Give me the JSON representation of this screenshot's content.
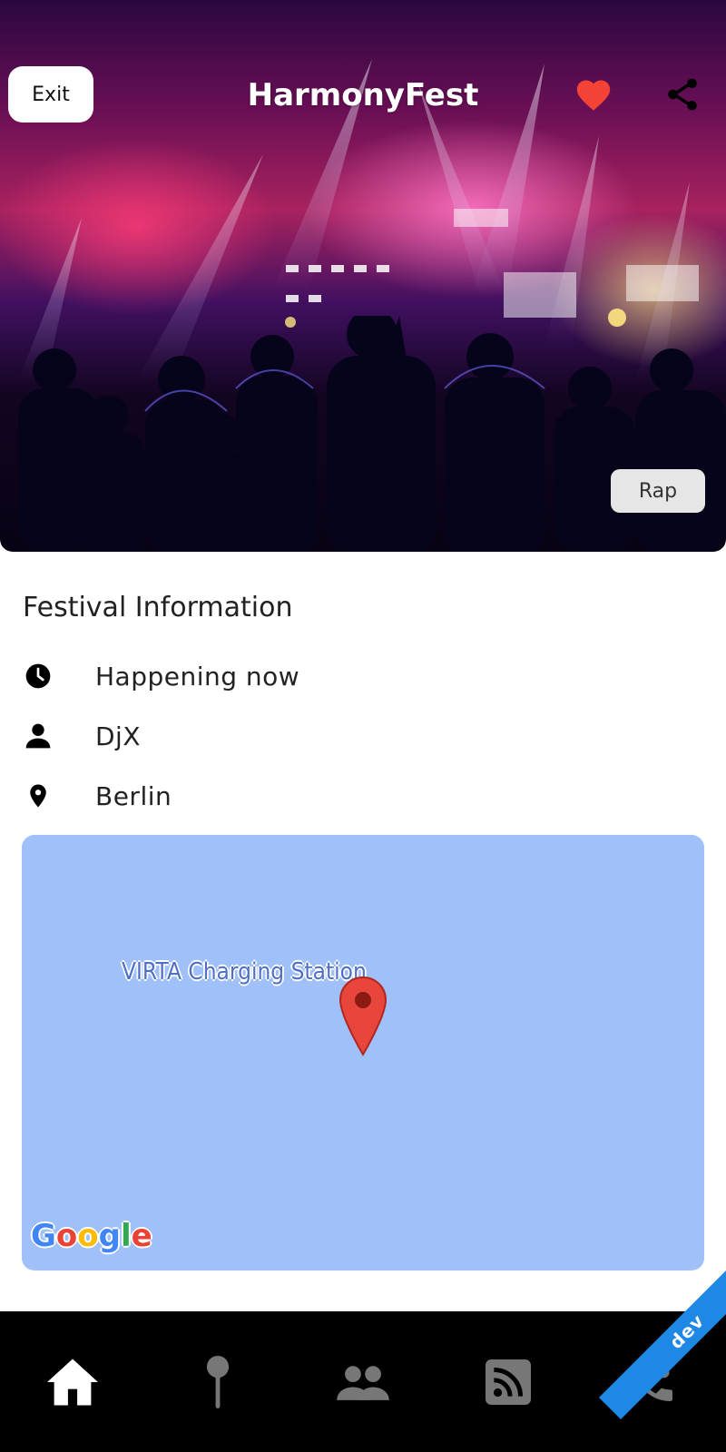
{
  "header": {
    "exit_label": "Exit",
    "title": "HarmonyFest",
    "favorite_icon": "heart-icon",
    "share_icon": "share-icon",
    "genre_tag": "Rap",
    "favorite_color": "#f44336"
  },
  "info": {
    "section_title": "Festival Information",
    "rows": [
      {
        "icon": "clock-icon",
        "text": "Happening now"
      },
      {
        "icon": "person-icon",
        "text": "DjX"
      },
      {
        "icon": "location-pin-icon",
        "text": "Berlin"
      }
    ]
  },
  "map": {
    "place_label": "VIRTA Charging Station",
    "provider_logo": "Google",
    "background_color": "#9fc0f8"
  },
  "bottom_nav": {
    "items": [
      {
        "icon": "home-icon",
        "active": true
      },
      {
        "icon": "pin-icon",
        "active": false
      },
      {
        "icon": "people-icon",
        "active": false
      },
      {
        "icon": "rss-feed-icon",
        "active": false
      },
      {
        "icon": "phone-fire-icon",
        "active": false
      }
    ]
  },
  "debug_banner": "dev"
}
